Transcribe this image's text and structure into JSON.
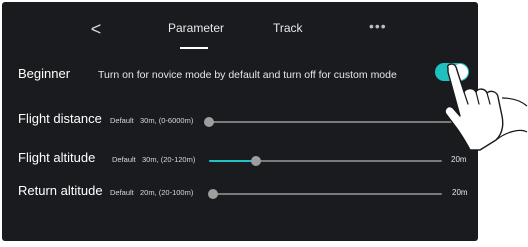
{
  "tabs": {
    "back_glyph": "<",
    "parameter": "Parameter",
    "track": "Track",
    "more_glyph": "•••"
  },
  "beginner": {
    "label": "Beginner",
    "description": "Turn on for novice mode by default and turn off for custom mode",
    "toggle_on": true
  },
  "flight_distance": {
    "label": "Flight distance",
    "default_text": "Default",
    "range_text": "30m, (0-6000m)",
    "end_value": "m",
    "level_fraction": 0.0
  },
  "flight_altitude": {
    "label": "Flight altitude",
    "default_text": "Default",
    "range_text": "30m, (20-120m)",
    "end_value": "20m",
    "level_fraction": 0.2
  },
  "return_altitude": {
    "label": "Return altitude",
    "default_text": "Default",
    "range_text": "20m, (20-100m)",
    "end_value": "20m",
    "level_fraction": 0.0
  },
  "colors": {
    "accent": "#20bfc0",
    "background": "#1a1b1f",
    "track": "#7a7a7a",
    "thumb": "#9e9e9e"
  }
}
